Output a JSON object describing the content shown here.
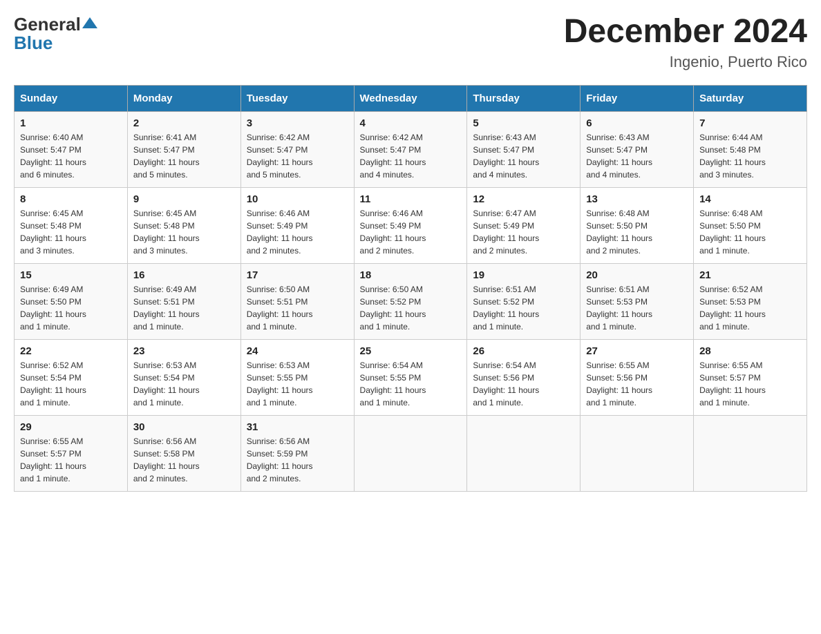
{
  "header": {
    "logo_line1": "General",
    "logo_line2": "Blue",
    "title": "December 2024",
    "subtitle": "Ingenio, Puerto Rico"
  },
  "days_of_week": [
    "Sunday",
    "Monday",
    "Tuesday",
    "Wednesday",
    "Thursday",
    "Friday",
    "Saturday"
  ],
  "weeks": [
    [
      {
        "day": "1",
        "info": "Sunrise: 6:40 AM\nSunset: 5:47 PM\nDaylight: 11 hours\nand 6 minutes."
      },
      {
        "day": "2",
        "info": "Sunrise: 6:41 AM\nSunset: 5:47 PM\nDaylight: 11 hours\nand 5 minutes."
      },
      {
        "day": "3",
        "info": "Sunrise: 6:42 AM\nSunset: 5:47 PM\nDaylight: 11 hours\nand 5 minutes."
      },
      {
        "day": "4",
        "info": "Sunrise: 6:42 AM\nSunset: 5:47 PM\nDaylight: 11 hours\nand 4 minutes."
      },
      {
        "day": "5",
        "info": "Sunrise: 6:43 AM\nSunset: 5:47 PM\nDaylight: 11 hours\nand 4 minutes."
      },
      {
        "day": "6",
        "info": "Sunrise: 6:43 AM\nSunset: 5:47 PM\nDaylight: 11 hours\nand 4 minutes."
      },
      {
        "day": "7",
        "info": "Sunrise: 6:44 AM\nSunset: 5:48 PM\nDaylight: 11 hours\nand 3 minutes."
      }
    ],
    [
      {
        "day": "8",
        "info": "Sunrise: 6:45 AM\nSunset: 5:48 PM\nDaylight: 11 hours\nand 3 minutes."
      },
      {
        "day": "9",
        "info": "Sunrise: 6:45 AM\nSunset: 5:48 PM\nDaylight: 11 hours\nand 3 minutes."
      },
      {
        "day": "10",
        "info": "Sunrise: 6:46 AM\nSunset: 5:49 PM\nDaylight: 11 hours\nand 2 minutes."
      },
      {
        "day": "11",
        "info": "Sunrise: 6:46 AM\nSunset: 5:49 PM\nDaylight: 11 hours\nand 2 minutes."
      },
      {
        "day": "12",
        "info": "Sunrise: 6:47 AM\nSunset: 5:49 PM\nDaylight: 11 hours\nand 2 minutes."
      },
      {
        "day": "13",
        "info": "Sunrise: 6:48 AM\nSunset: 5:50 PM\nDaylight: 11 hours\nand 2 minutes."
      },
      {
        "day": "14",
        "info": "Sunrise: 6:48 AM\nSunset: 5:50 PM\nDaylight: 11 hours\nand 1 minute."
      }
    ],
    [
      {
        "day": "15",
        "info": "Sunrise: 6:49 AM\nSunset: 5:50 PM\nDaylight: 11 hours\nand 1 minute."
      },
      {
        "day": "16",
        "info": "Sunrise: 6:49 AM\nSunset: 5:51 PM\nDaylight: 11 hours\nand 1 minute."
      },
      {
        "day": "17",
        "info": "Sunrise: 6:50 AM\nSunset: 5:51 PM\nDaylight: 11 hours\nand 1 minute."
      },
      {
        "day": "18",
        "info": "Sunrise: 6:50 AM\nSunset: 5:52 PM\nDaylight: 11 hours\nand 1 minute."
      },
      {
        "day": "19",
        "info": "Sunrise: 6:51 AM\nSunset: 5:52 PM\nDaylight: 11 hours\nand 1 minute."
      },
      {
        "day": "20",
        "info": "Sunrise: 6:51 AM\nSunset: 5:53 PM\nDaylight: 11 hours\nand 1 minute."
      },
      {
        "day": "21",
        "info": "Sunrise: 6:52 AM\nSunset: 5:53 PM\nDaylight: 11 hours\nand 1 minute."
      }
    ],
    [
      {
        "day": "22",
        "info": "Sunrise: 6:52 AM\nSunset: 5:54 PM\nDaylight: 11 hours\nand 1 minute."
      },
      {
        "day": "23",
        "info": "Sunrise: 6:53 AM\nSunset: 5:54 PM\nDaylight: 11 hours\nand 1 minute."
      },
      {
        "day": "24",
        "info": "Sunrise: 6:53 AM\nSunset: 5:55 PM\nDaylight: 11 hours\nand 1 minute."
      },
      {
        "day": "25",
        "info": "Sunrise: 6:54 AM\nSunset: 5:55 PM\nDaylight: 11 hours\nand 1 minute."
      },
      {
        "day": "26",
        "info": "Sunrise: 6:54 AM\nSunset: 5:56 PM\nDaylight: 11 hours\nand 1 minute."
      },
      {
        "day": "27",
        "info": "Sunrise: 6:55 AM\nSunset: 5:56 PM\nDaylight: 11 hours\nand 1 minute."
      },
      {
        "day": "28",
        "info": "Sunrise: 6:55 AM\nSunset: 5:57 PM\nDaylight: 11 hours\nand 1 minute."
      }
    ],
    [
      {
        "day": "29",
        "info": "Sunrise: 6:55 AM\nSunset: 5:57 PM\nDaylight: 11 hours\nand 1 minute."
      },
      {
        "day": "30",
        "info": "Sunrise: 6:56 AM\nSunset: 5:58 PM\nDaylight: 11 hours\nand 2 minutes."
      },
      {
        "day": "31",
        "info": "Sunrise: 6:56 AM\nSunset: 5:59 PM\nDaylight: 11 hours\nand 2 minutes."
      },
      null,
      null,
      null,
      null
    ]
  ]
}
